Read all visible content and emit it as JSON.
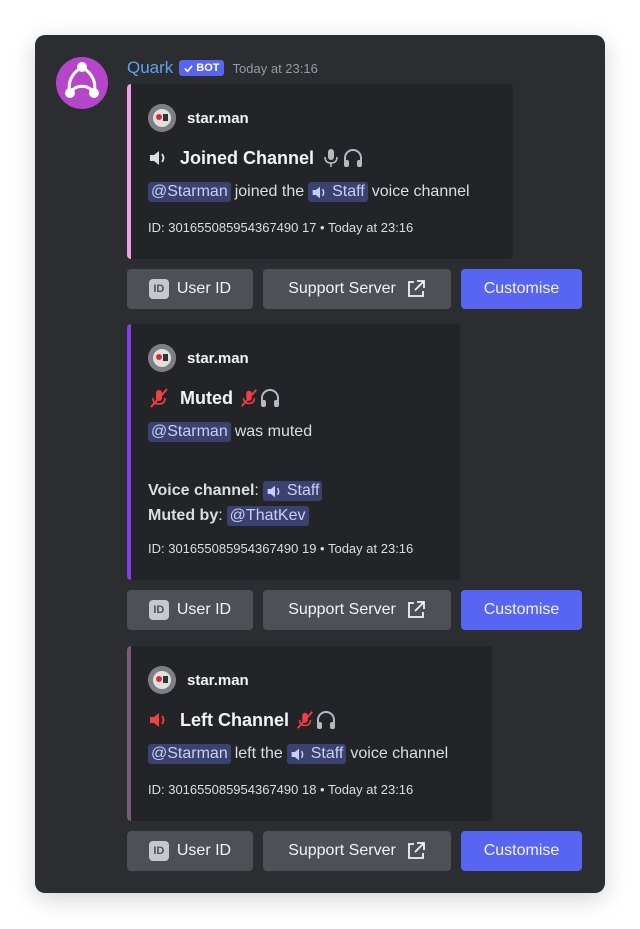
{
  "message": {
    "username": "Quark",
    "bot_tag": "BOT",
    "timestamp": "Today at 23:16",
    "colors": {
      "username": "#5ea3f2",
      "bot_tag": "#5865f2",
      "avatar": "#b646c9"
    }
  },
  "embeds": [
    {
      "author": "star.man",
      "title": "Joined Channel",
      "accent_color": "#f49ee7",
      "line1": {
        "mention": "@Starman",
        "text_before_channel": "joined the",
        "channel": "Staff",
        "text_after_channel": "voice channel"
      },
      "footer": "ID: 301655085954367490 17 • Today at 23:16"
    },
    {
      "author": "star.man",
      "title": "Muted",
      "accent_color": "#8b3ce8",
      "line1": {
        "mention": "@Starman",
        "text": "was muted"
      },
      "fields": [
        {
          "label": "Voice channel",
          "sep": ":",
          "value": "Staff"
        },
        {
          "label": "Muted by",
          "sep": ":",
          "value": "@ThatKev"
        }
      ],
      "footer": "ID: 301655085954367490 19 • Today at 23:16"
    },
    {
      "author": "star.man",
      "title": "Left Channel",
      "accent_color": "#7a5c7a",
      "line1": {
        "mention": "@Starman",
        "text_before_channel": "left the",
        "channel": "Staff",
        "text_after_channel": "voice channel"
      },
      "footer": "ID: 301655085954367490 18 • Today at 23:16"
    }
  ],
  "buttons": {
    "user_id": "User ID",
    "id_icon": "ID",
    "support": "Support Server",
    "customise": "Customise"
  }
}
